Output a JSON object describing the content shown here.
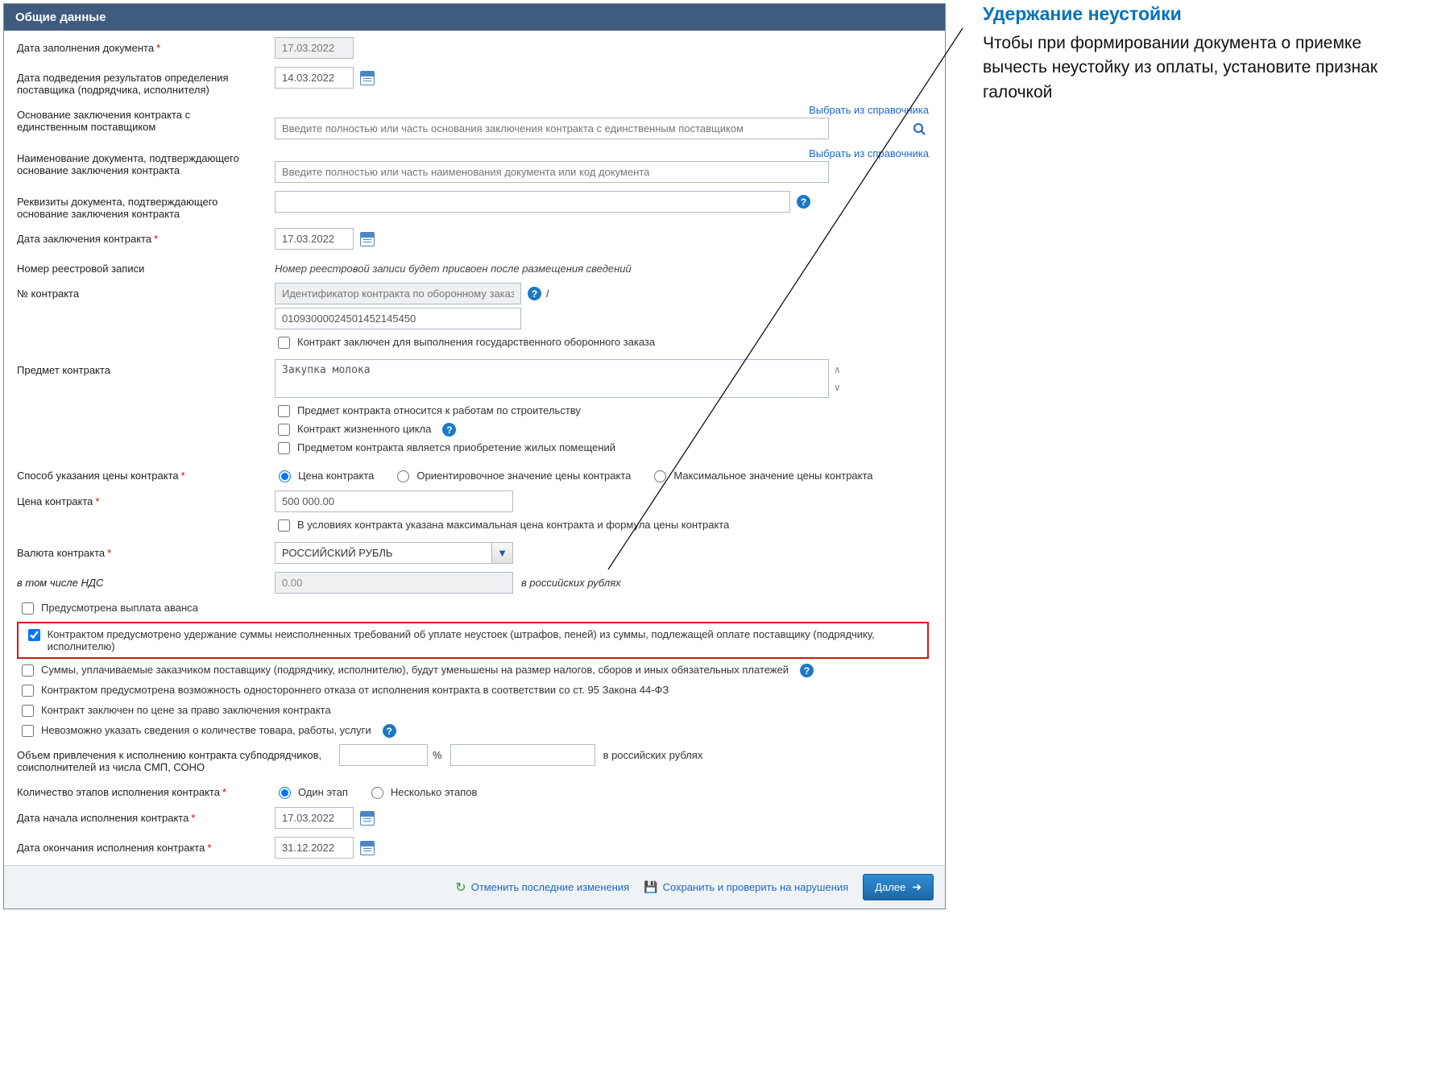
{
  "header": {
    "title": "Общие данные"
  },
  "labels": {
    "fill_date": "Дата заполнения документа",
    "supplier_result_date": "Дата подведения результатов определения поставщика (подрядчика, исполнителя)",
    "basis_single": "Основание заключения контракта с единственным поставщиком",
    "doc_name_basis": "Наименование документа, подтверждающего основание заключения контракта",
    "doc_requisites": "Реквизиты документа, подтверждающего основание заключения контракта",
    "contract_date": "Дата заключения контракта",
    "registry_num": "Номер реестровой записи",
    "contract_num": "№ контракта",
    "contract_subject": "Предмет контракта",
    "price_method": "Способ указания цены контракта",
    "price": "Цена контракта",
    "currency": "Валюта контракта",
    "vat": "в том числе НДС",
    "sub_volume": "Объем привлечения к исполнению контракта субподрядчиков, соисполнителей из числа СМП, СОНО",
    "stages_count": "Количество этапов исполнения контракта",
    "exec_start": "Дата начала исполнения контракта",
    "exec_end": "Дата окончания исполнения контракта"
  },
  "links": {
    "from_directory": "Выбрать из справочника"
  },
  "values": {
    "fill_date": "17.03.2022",
    "supplier_result_date": "14.03.2022",
    "contract_date": "17.03.2022",
    "registry_note": "Номер реестровой записи будет присвоен после размещения сведений",
    "contract_id_placeholder": "Идентификатор контракта по оборонному заказу",
    "contract_id_suffix": "/",
    "contract_num": "01093000024501452145450",
    "subject": "Закупка молока",
    "price": "500 000.00",
    "currency": "РОССИЙСКИЙ РУБЛЬ",
    "vat": "0.00",
    "rub_label": "в российских рублях",
    "percent_sign": "%",
    "exec_start": "17.03.2022",
    "exec_end": "31.12.2022"
  },
  "placeholders": {
    "basis_single": "Введите полностью или часть основания заключения контракта с единственным поставщиком",
    "doc_name_basis": "Введите полностью или часть наименования документа или код документа"
  },
  "checkboxes": {
    "defense_order": "Контракт заключен для выполнения государственного оборонного заказа",
    "construction": "Предмет контракта относится к работам по строительству",
    "lifecycle": "Контракт жизненного цикла",
    "housing": "Предметом контракта является приобретение жилых помещений",
    "max_price_formula": "В условиях контракта указана максимальная цена контракта и формула цены контракта",
    "advance": "Предусмотрена выплата аванса",
    "penalty_withhold": "Контрактом предусмотрено удержание суммы неисполненных требований об уплате неустоек (штрафов, пеней) из суммы, подлежащей оплате поставщику (подрядчику, исполнителю)",
    "tax_reduce": "Суммы, уплачиваемые заказчиком поставщику (подрядчику, исполнителю), будут уменьшены на размер налогов, сборов и иных обязательных платежей",
    "unilateral": "Контрактом предусмотрена возможность одностороннего отказа от исполнения контракта в соответствии со ст. 95 Закона 44-ФЗ",
    "right_price": "Контракт заключен по цене за право заключения контракта",
    "no_quantity": "Невозможно указать сведения о количестве товара, работы, услуги"
  },
  "radios": {
    "price_contract": "Цена контракта",
    "price_orient": "Ориентировочное значение цены контракта",
    "price_max": "Максимальное значение цены контракта",
    "stage_one": "Один этап",
    "stage_many": "Несколько этапов"
  },
  "footer": {
    "undo": "Отменить последние изменения",
    "save": "Сохранить и проверить на нарушения",
    "next": "Далее"
  },
  "annotation": {
    "title": "Удержание неустойки",
    "body": "Чтобы при формировании документа о приемке вычесть неустойку из оплаты, установите признак галочкой"
  }
}
